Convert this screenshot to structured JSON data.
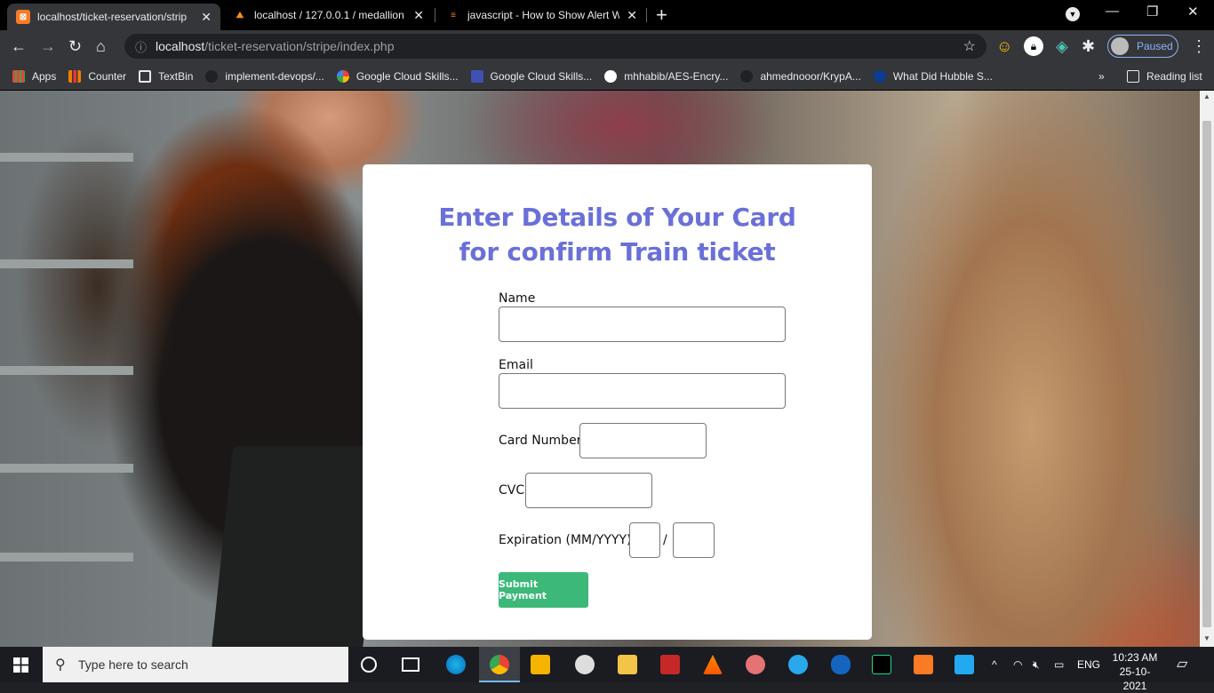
{
  "browser": {
    "tabs": [
      {
        "title": "localhost/ticket-reservation/strip",
        "active": true
      },
      {
        "title": "localhost / 127.0.0.1 / medallion",
        "active": false
      },
      {
        "title": "javascript - How to Show Alert W",
        "active": false
      }
    ],
    "url_host": "localhost",
    "url_path": "/ticket-reservation/stripe/index.php",
    "profile_status": "Paused",
    "bookmarks": [
      "Apps",
      "Counter",
      "TextBin",
      "implement-devops/...",
      "Google Cloud Skills...",
      "Google Cloud Skills...",
      "mhhabib/AES-Encry...",
      "ahmednooor/KrypA...",
      "What Did Hubble S..."
    ],
    "reading_list": "Reading list"
  },
  "form": {
    "heading_line1": "Enter Details of Your Card",
    "heading_line2": "for confirm Train ticket",
    "name_label": "Name",
    "name_value": "",
    "email_label": "Email",
    "email_value": "",
    "card_label": "Card Number",
    "card_value": "",
    "cvc_label": "CVC",
    "cvc_value": "",
    "expiration_label": "Expiration (MM/YYYY)",
    "exp_month": "",
    "exp_year": "",
    "separator": "/",
    "submit_label": "Submit Payment"
  },
  "taskbar": {
    "search_placeholder": "Type here to search",
    "language": "ENG",
    "time": "10:23 AM",
    "date": "25-10-2021"
  },
  "colors": {
    "heading": "#6a70d8",
    "submit_bg": "#3cb878",
    "browser_dark": "#35363a"
  }
}
